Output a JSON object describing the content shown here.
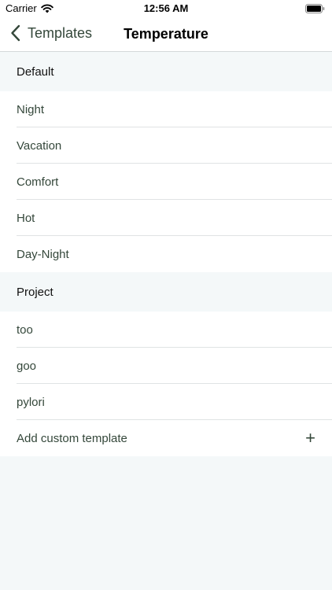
{
  "status": {
    "carrier": "Carrier",
    "time": "12:56 AM"
  },
  "nav": {
    "back_label": "Templates",
    "title": "Temperature"
  },
  "sections": {
    "default": {
      "header": "Default",
      "items": [
        "Night",
        "Vacation",
        "Comfort",
        "Hot",
        "Day-Night"
      ]
    },
    "project": {
      "header": "Project",
      "items": [
        "too",
        "goo",
        "pylori"
      ],
      "add_label": "Add custom template"
    }
  },
  "colors": {
    "accent": "#34473a",
    "background": "#f4f8f9"
  },
  "icons": {
    "back": "chevron-left-icon",
    "add": "plus-icon",
    "wifi": "wifi-icon",
    "battery": "battery-icon"
  }
}
